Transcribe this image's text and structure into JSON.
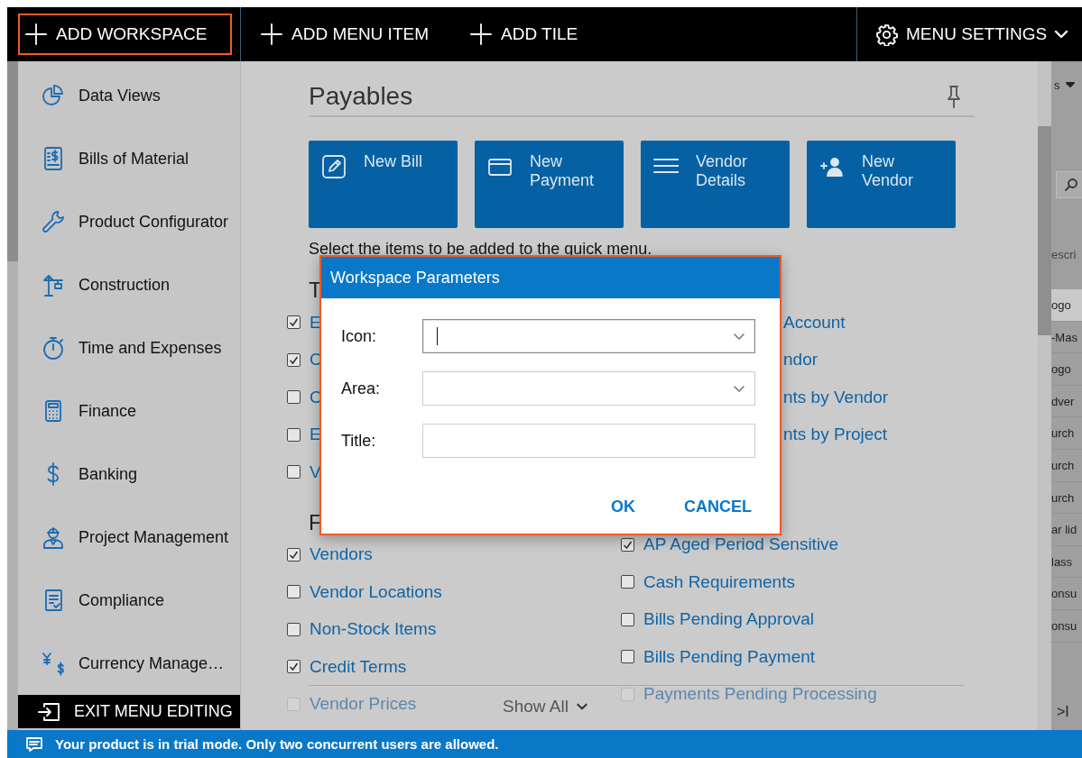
{
  "toolbar": {
    "items": [
      {
        "label": "ADD WORKSPACE",
        "highlighted": true
      },
      {
        "label": "ADD MENU ITEM",
        "highlighted": false
      },
      {
        "label": "ADD TILE",
        "highlighted": false
      }
    ],
    "settings": {
      "label": "MENU SETTINGS"
    }
  },
  "sidebar": {
    "items": [
      {
        "label": "Data Views"
      },
      {
        "label": "Bills of Material"
      },
      {
        "label": "Product Configurator"
      },
      {
        "label": "Construction"
      },
      {
        "label": "Time and Expenses"
      },
      {
        "label": "Finance"
      },
      {
        "label": "Banking"
      },
      {
        "label": "Project Management"
      },
      {
        "label": "Compliance"
      },
      {
        "label": "Currency Manage…"
      }
    ],
    "exit_button": {
      "label": "EXIT MENU EDITING"
    }
  },
  "workspace": {
    "title": "Payables",
    "tiles": [
      {
        "label": "New Bill"
      },
      {
        "label": "New Payment"
      },
      {
        "label": "Vendor Details"
      },
      {
        "label": "New Vendor"
      }
    ],
    "instruction": "Select the items to be added to the quick menu.",
    "sections": [
      {
        "heading": "T",
        "left": [
          {
            "kind": "check",
            "label": "E",
            "checked": true,
            "faded": false
          },
          {
            "kind": "check",
            "label": "C",
            "checked": true,
            "faded": false
          },
          {
            "kind": "check",
            "label": "C",
            "checked": false,
            "faded": false
          },
          {
            "kind": "check",
            "label": "E",
            "checked": false,
            "faded": false
          },
          {
            "kind": "check",
            "label": "V",
            "checked": false,
            "faded": false
          }
        ],
        "right": [
          {
            "kind": "fragment",
            "label": "Account"
          },
          {
            "kind": "fragment",
            "label": "ndor"
          },
          {
            "kind": "fragment",
            "label": "nts by Vendor"
          },
          {
            "kind": "fragment",
            "label": "nts by Project"
          }
        ]
      },
      {
        "heading": "F",
        "left": [
          {
            "kind": "check",
            "label": "Vendors",
            "checked": true,
            "faded": false
          },
          {
            "kind": "check",
            "label": "Vendor Locations",
            "checked": false,
            "faded": false
          },
          {
            "kind": "check",
            "label": "Non-Stock Items",
            "checked": false,
            "faded": false
          },
          {
            "kind": "check",
            "label": "Credit Terms",
            "checked": true,
            "faded": false
          },
          {
            "kind": "check",
            "label": "Vendor Prices",
            "checked": false,
            "faded": true
          }
        ],
        "right": [
          {
            "kind": "check",
            "label": "AP Aged Period Sensitive",
            "checked": true,
            "faded": false
          },
          {
            "kind": "check",
            "label": "Cash Requirements",
            "checked": false,
            "faded": false
          },
          {
            "kind": "check",
            "label": "Bills Pending Approval",
            "checked": false,
            "faded": false
          },
          {
            "kind": "check",
            "label": "Bills Pending Payment",
            "checked": false,
            "faded": false
          },
          {
            "kind": "check",
            "label": "Payments Pending Processing",
            "checked": false,
            "faded": true
          }
        ]
      }
    ],
    "show_all": {
      "label": "Show All"
    }
  },
  "dialog": {
    "title": "Workspace Parameters",
    "fields": [
      {
        "label": "Icon:",
        "kind": "select",
        "focused": true
      },
      {
        "label": "Area:",
        "kind": "select",
        "focused": false
      },
      {
        "label": "Title:",
        "kind": "text",
        "focused": false
      }
    ],
    "buttons": [
      "OK",
      "CANCEL"
    ]
  },
  "background_app": {
    "menu": "s",
    "header": "escri",
    "rows": [
      {
        "text": "ogo",
        "selected": true
      },
      {
        "text": "-Mas",
        "selected": false
      },
      {
        "text": "ogo",
        "selected": false
      },
      {
        "text": "dver",
        "selected": false
      },
      {
        "text": "urch",
        "selected": false
      },
      {
        "text": "urch",
        "selected": false
      },
      {
        "text": "urch",
        "selected": false
      },
      {
        "text": "ar lid",
        "selected": false
      },
      {
        "text": "lass",
        "selected": false
      },
      {
        "text": "onsu",
        "selected": false
      },
      {
        "text": "onsu",
        "selected": false
      }
    ],
    "pager": ">I"
  },
  "status_bar": {
    "message": "Your product is in trial mode. Only two concurrent users are allowed."
  }
}
